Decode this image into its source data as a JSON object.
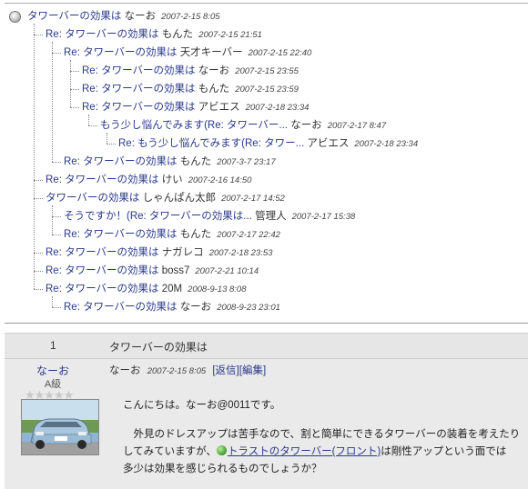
{
  "thread": [
    {
      "subject": "タワーバーの効果は",
      "author": "なーお",
      "date": "2007-2-15 8:05",
      "depth": 0
    },
    {
      "subject": "Re: タワーバーの効果は",
      "author": "もんた",
      "date": "2007-2-15 21:51",
      "depth": 1
    },
    {
      "subject": "Re: タワーバーの効果は",
      "author": "天才キーバー",
      "date": "2007-2-15 22:40",
      "depth": 2
    },
    {
      "subject": "Re: タワーバーの効果は",
      "author": "なーお",
      "date": "2007-2-15 23:55",
      "depth": 3
    },
    {
      "subject": "Re: タワーバーの効果は",
      "author": "もんた",
      "date": "2007-2-15 23:59",
      "depth": 3
    },
    {
      "subject": "Re: タワーバーの効果は",
      "author": "アビエス",
      "date": "2007-2-18 23:34",
      "depth": 3
    },
    {
      "subject": "もう少し悩んでみます(Re: タワーバー...",
      "author": "なーお",
      "date": "2007-2-17 8:47",
      "depth": 4
    },
    {
      "subject": "Re: もう少し悩んでみます(Re: タワー...",
      "author": "アビエス",
      "date": "2007-2-18 23:34",
      "depth": 5
    },
    {
      "subject": "Re: タワーバーの効果は",
      "author": "もんた",
      "date": "2007-3-7 23:17",
      "depth": 2
    },
    {
      "subject": "Re: タワーバーの効果は",
      "author": "けい",
      "date": "2007-2-16 14:50",
      "depth": 1
    },
    {
      "subject": "タワーバーの効果は",
      "author": "しゃんぱん太郎",
      "date": "2007-2-17 14:52",
      "depth": 1
    },
    {
      "subject": "そうですか！(Re: タワーバーの効果は...",
      "author": "管理人",
      "date": "2007-2-17 15:38",
      "depth": 2
    },
    {
      "subject": "Re: タワーバーの効果は",
      "author": "もんた",
      "date": "2007-2-17 22:42",
      "depth": 2
    },
    {
      "subject": "Re: タワーバーの効果は",
      "author": "ナガレコ",
      "date": "2007-2-18 23:53",
      "depth": 1
    },
    {
      "subject": "Re: タワーバーの効果は",
      "author": "boss7",
      "date": "2007-2-21 10:14",
      "depth": 1
    },
    {
      "subject": "Re: タワーバーの効果は",
      "author": "20M",
      "date": "2008-9-13 8:08",
      "depth": 1
    },
    {
      "subject": "Re: タワーバーの効果は",
      "author": "なーお",
      "date": "2008-9-23 23:01",
      "depth": 2
    }
  ],
  "post": {
    "number": "1",
    "title": "タワーバーの効果は",
    "username": "なーお",
    "rank": "A級",
    "stars": "★★★★★",
    "author": "なーお",
    "date": "2007-2-15 8:05",
    "reply_label": "[返信]",
    "edit_label": "[編集]",
    "greeting": "こんにちは。なーお@0011です。",
    "line1": "外見のドレスアップは苦手なので、割と簡単にできるタワーバーの装着を考えたり",
    "line2_pre": "してみていますが、",
    "link_text": "トラストのタワーバー(フロント)",
    "line2_post": "は剛性アップという面では",
    "line3": "多少は効果を感じられるものでしょうか？"
  }
}
